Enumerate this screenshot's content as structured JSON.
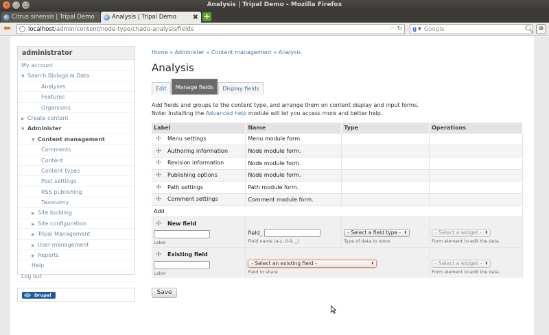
{
  "window": {
    "title": "Analysis | Tripal Demo - Mozilla Firefox",
    "buttons": {
      "close": "×",
      "minimize": "–",
      "maximize": "□"
    }
  },
  "browser_tabs": [
    {
      "label": "Citrus sinensis | Tripal Demo"
    },
    {
      "label": "Analysis | Tripal Demo",
      "close": "✖"
    }
  ],
  "new_tab_label": "+",
  "url": {
    "host": "localhost",
    "path": "/admin/content/node-type/chado-analysis/fields"
  },
  "search": {
    "engine": "g",
    "placeholder": "Google"
  },
  "sidebar": {
    "title": "administrator",
    "items": [
      {
        "label": "My account",
        "level": 0,
        "arrow": ""
      },
      {
        "label": "Search Biological Data",
        "level": 0,
        "arrow": "▼"
      },
      {
        "label": "Analyses",
        "level": 2,
        "arrow": ""
      },
      {
        "label": "Features",
        "level": 2,
        "arrow": ""
      },
      {
        "label": "Organisms",
        "level": 2,
        "arrow": ""
      },
      {
        "label": "Create content",
        "level": 0,
        "arrow": "▶"
      },
      {
        "label": "Administer",
        "level": 0,
        "arrow": "▼",
        "bold": true
      },
      {
        "label": "Content management",
        "level": 1,
        "arrow": "▼",
        "bold": true
      },
      {
        "label": "Comments",
        "level": 2,
        "arrow": ""
      },
      {
        "label": "Content",
        "level": 2,
        "arrow": ""
      },
      {
        "label": "Content types",
        "level": 2,
        "arrow": ""
      },
      {
        "label": "Post settings",
        "level": 2,
        "arrow": ""
      },
      {
        "label": "RSS publishing",
        "level": 2,
        "arrow": ""
      },
      {
        "label": "Taxonomy",
        "level": 2,
        "arrow": ""
      },
      {
        "label": "Site building",
        "level": 1,
        "arrow": "▶"
      },
      {
        "label": "Site configuration",
        "level": 1,
        "arrow": "▶"
      },
      {
        "label": "Tripal Management",
        "level": 1,
        "arrow": "▶"
      },
      {
        "label": "User management",
        "level": 1,
        "arrow": "▶"
      },
      {
        "label": "Reports",
        "level": 1,
        "arrow": "▶"
      },
      {
        "label": "Help",
        "level": 1,
        "arrow": ""
      },
      {
        "label": "Log out",
        "level": 0,
        "arrow": ""
      }
    ],
    "drupal_badge": "Drupal"
  },
  "breadcrumb": [
    "Home",
    "Administer",
    "Content management",
    "Analysis"
  ],
  "breadcrumb_separator": " » ",
  "page_title": "Analysis",
  "tabs": [
    {
      "label": "Edit",
      "active": false
    },
    {
      "label": "Manage fields",
      "active": true
    },
    {
      "label": "Display fields",
      "active": false
    }
  ],
  "description": {
    "line1": "Add fields and groups to the content type, and arrange them on content display and input forms.",
    "line2_before": "Note: Installing the ",
    "line2_link": "Advanced help",
    "line2_after": " module will let you access more and better help."
  },
  "table": {
    "headers": [
      "Label",
      "Name",
      "Type",
      "Operations"
    ],
    "rows": [
      {
        "label": "Menu settings",
        "name": "Menu module form."
      },
      {
        "label": "Authoring information",
        "name": "Node module form."
      },
      {
        "label": "Revision information",
        "name": "Node module form."
      },
      {
        "label": "Publishing options",
        "name": "Node module form."
      },
      {
        "label": "Path settings",
        "name": "Path module form."
      },
      {
        "label": "Comment settings",
        "name": "Comment module form."
      }
    ],
    "add_label": "Add",
    "new_field": {
      "title": "New field",
      "label_value": "",
      "label_hint": "Label",
      "name_prefix": "field_",
      "name_value": "",
      "name_hint": "Field name (a-z, 0-9, _)",
      "type_select": "- Select a field type -",
      "type_hint": "Type of data to store.",
      "widget_select": "- Select a widget -",
      "widget_hint": "Form element to edit the data."
    },
    "existing_field": {
      "title": "Existing field",
      "label_value": "",
      "label_hint": "Label",
      "field_select": "- Select an existing field -",
      "field_hint": "Field to share",
      "widget_select": "- Select a widget -",
      "widget_hint": "Form element to edit the data."
    }
  },
  "save_label": "Save"
}
